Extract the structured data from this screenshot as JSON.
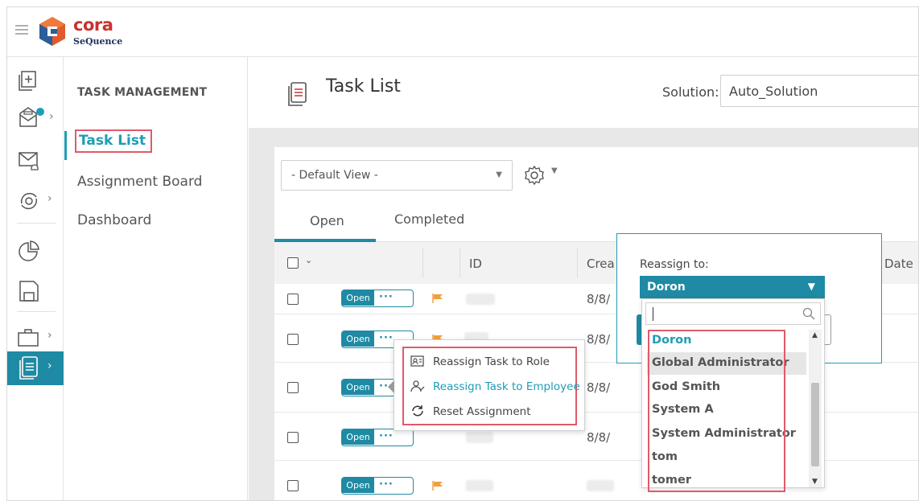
{
  "brand": {
    "name": "cora",
    "product": "SeQuence"
  },
  "subnav": {
    "title": "TASK MANAGEMENT",
    "items": [
      {
        "label": "Task List"
      },
      {
        "label": "Assignment Board"
      },
      {
        "label": "Dashboard"
      }
    ]
  },
  "page": {
    "title": "Task List"
  },
  "solution": {
    "label": "Solution:",
    "value": "Auto_Solution"
  },
  "view": {
    "selected": "- Default View -"
  },
  "tabs": [
    {
      "label": "Open"
    },
    {
      "label": "Completed"
    }
  ],
  "table": {
    "columns": {
      "id": "ID",
      "created": "Crea",
      "date": "Date"
    },
    "rows": [
      {
        "status": "Open",
        "created": "8/8/"
      },
      {
        "status": "Open",
        "created": "8/8/"
      },
      {
        "status": "Open",
        "created": "8/8/"
      },
      {
        "status": "Open",
        "created": "8/8/"
      },
      {
        "status": "Open",
        "created": ""
      }
    ],
    "dots": "···"
  },
  "context_menu": {
    "items": [
      {
        "label": "Reassign Task to Role",
        "icon": "role-card-icon"
      },
      {
        "label": "Reassign Task to Employee",
        "icon": "employee-icon"
      },
      {
        "label": "Reset Assignment",
        "icon": "reset-icon"
      }
    ]
  },
  "reassign": {
    "label": "Reassign to:",
    "selected": "Doron",
    "options": [
      {
        "label": "Doron"
      },
      {
        "label": "Global Administrator"
      },
      {
        "label": "God Smith"
      },
      {
        "label": "System A"
      },
      {
        "label": "System Administrator"
      },
      {
        "label": "tom"
      },
      {
        "label": "tomer"
      }
    ]
  },
  "colors": {
    "accent": "#1f8aa3",
    "accent_text": "#1f9cb6",
    "highlight": "#e05a6a",
    "brand_red": "#c8332e",
    "flag": "#f0a040"
  }
}
